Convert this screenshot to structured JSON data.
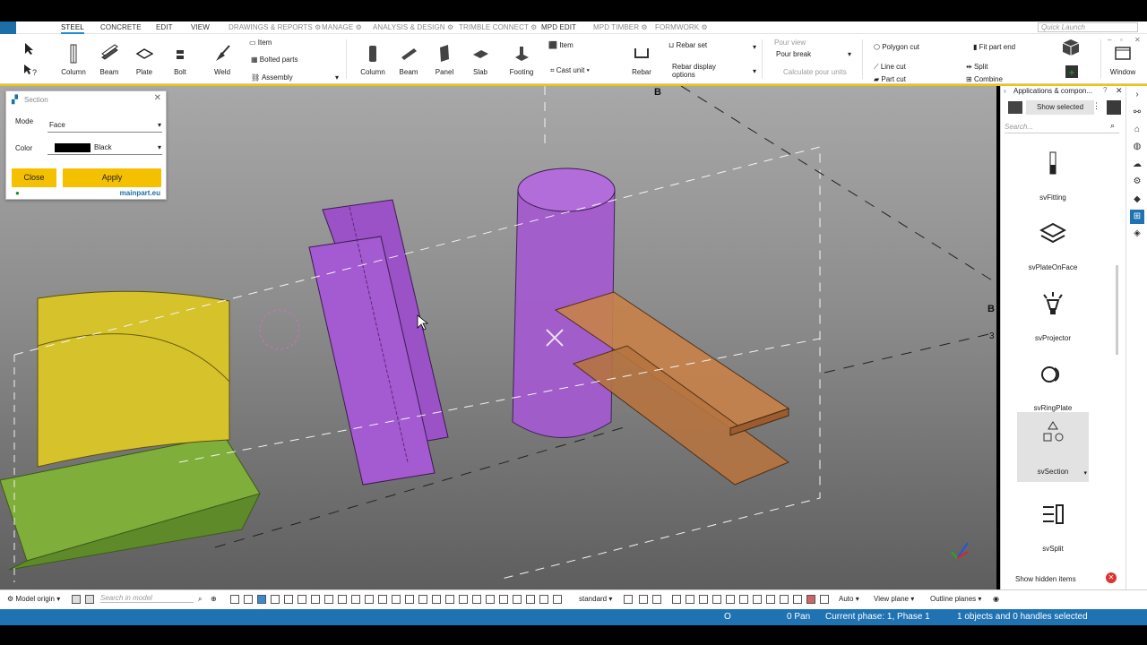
{
  "tabs": [
    "STEEL",
    "CONCRETE",
    "EDIT",
    "VIEW",
    "DRAWINGS & REPORTS ⚙",
    "MANAGE ⚙",
    "ANALYSIS & DESIGN ⚙",
    "TRIMBLE CONNECT ⚙",
    "MPD EDIT",
    "MPD TIMBER ⚙",
    "FORMWORK ⚙"
  ],
  "quick_launch": "Quick Launch",
  "ribbon": {
    "steel": [
      "Column",
      "Beam",
      "Plate",
      "Bolt",
      "Weld"
    ],
    "steel_small": [
      "Item",
      "Bolted parts",
      "Assembly"
    ],
    "concrete": [
      "Column",
      "Beam",
      "Panel",
      "Slab",
      "Footing",
      "Rebar"
    ],
    "concrete_small": [
      "Item",
      "Cast unit",
      "Rebar set",
      "Rebar display options"
    ],
    "pour": [
      "Pour view",
      "Pour break",
      "Calculate pour units"
    ],
    "cuts": [
      "Polygon cut",
      "Line cut",
      "Part cut",
      "Fit part end",
      "Split",
      "Combine"
    ],
    "window": "Window"
  },
  "section_panel": {
    "title": "Section",
    "mode_label": "Mode",
    "mode_value": "Face",
    "color_label": "Color",
    "color_value": "Black",
    "close": "Close",
    "apply": "Apply",
    "brand": "mainpart.eu"
  },
  "viewport": {
    "label_b_top": "B",
    "label_b_right": "B",
    "label_3": "3"
  },
  "apps_panel": {
    "title": "Applications & compon...",
    "show_selected": "Show selected",
    "search_placeholder": "Search...",
    "items": [
      "svFitting",
      "svPlateOnFace",
      "svProjector",
      "svRingPlate",
      "svSection",
      "svSplit"
    ],
    "show_hidden": "Show hidden items"
  },
  "bottom_toolbar": {
    "model_origin": "Model origin",
    "search_placeholder": "Search in model",
    "standard": "standard",
    "auto": "Auto",
    "view_plane": "View plane",
    "outline_planes": "Outline planes"
  },
  "status": {
    "o": "O",
    "pan": "0 Pan",
    "phase": "Current phase: 1, Phase 1",
    "selection": "1 objects and 0 handles selected"
  },
  "colors": {
    "accent_blue": "#1f73b3",
    "yellow": "#f5c000",
    "purple": "#9a4fc0",
    "orange": "#c8824a",
    "green": "#7aa83a"
  }
}
